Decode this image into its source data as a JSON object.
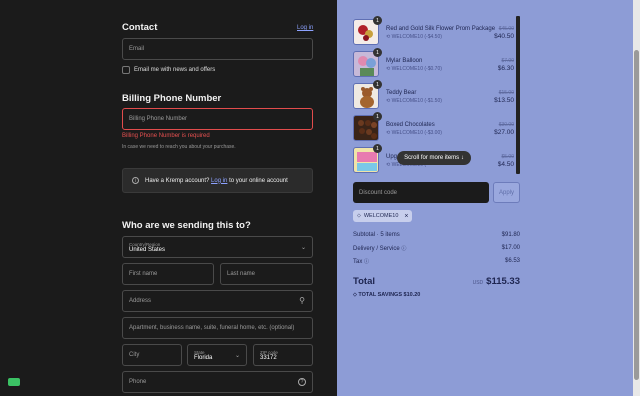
{
  "contact": {
    "title": "Contact",
    "login_link": "Log in",
    "email_placeholder": "Email",
    "newsletter_label": "Email me with news and offers"
  },
  "billing": {
    "title": "Billing Phone Number",
    "placeholder": "Billing Phone Number",
    "error": "Billing Phone Number is required",
    "note": "In case we need to reach you about your purchase."
  },
  "account_banner": {
    "prefix": "Have a Kremp account?",
    "link": "Log in",
    "suffix": "to your online account"
  },
  "shipping": {
    "title": "Who are we sending this to?",
    "country_label": "Country/Region",
    "country_value": "United States",
    "first_name": "First name",
    "last_name": "Last name",
    "address": "Address",
    "apartment": "Apartment, business name, suite, funeral home, etc. (optional)",
    "city": "City",
    "state_label": "State",
    "state_value": "Florida",
    "zip_label": "ZIP code",
    "zip_value": "33172",
    "phone": "Phone"
  },
  "cart": {
    "items": [
      {
        "qty": "1",
        "name": "Red and Gold Silk Flower Prom Package",
        "discount": "WELCOME10 (-$4.50)",
        "old_price": "$45.00",
        "price": "$40.50"
      },
      {
        "qty": "1",
        "name": "Mylar Balloon",
        "discount": "WELCOME10 (-$0.70)",
        "old_price": "$7.00",
        "price": "$6.30"
      },
      {
        "qty": "1",
        "name": "Teddy Bear",
        "discount": "WELCOME10 (-$1.50)",
        "old_price": "$15.00",
        "price": "$13.50"
      },
      {
        "qty": "1",
        "name": "Boxed Chocolates",
        "discount": "WELCOME10 (-$3.00)",
        "old_price": "$30.00",
        "price": "$27.00"
      },
      {
        "qty": "1",
        "name": "Upg",
        "discount": "WELCOME10 (",
        "old_price": "$5.00",
        "price": "$4.50"
      }
    ],
    "scroll_hint": "Scroll for more items"
  },
  "discount": {
    "placeholder": "Discount code",
    "apply_label": "Apply",
    "applied_code": "WELCOME10"
  },
  "summary": {
    "subtotal_label": "Subtotal · 5 items",
    "subtotal_value": "$91.80",
    "delivery_label": "Delivery / Service",
    "delivery_value": "$17.00",
    "tax_label": "Tax",
    "tax_value": "$6.53",
    "total_label": "Total",
    "currency": "USD",
    "total_value": "$115.33",
    "savings_label": "TOTAL SAVINGS",
    "savings_value": "$10.20"
  }
}
